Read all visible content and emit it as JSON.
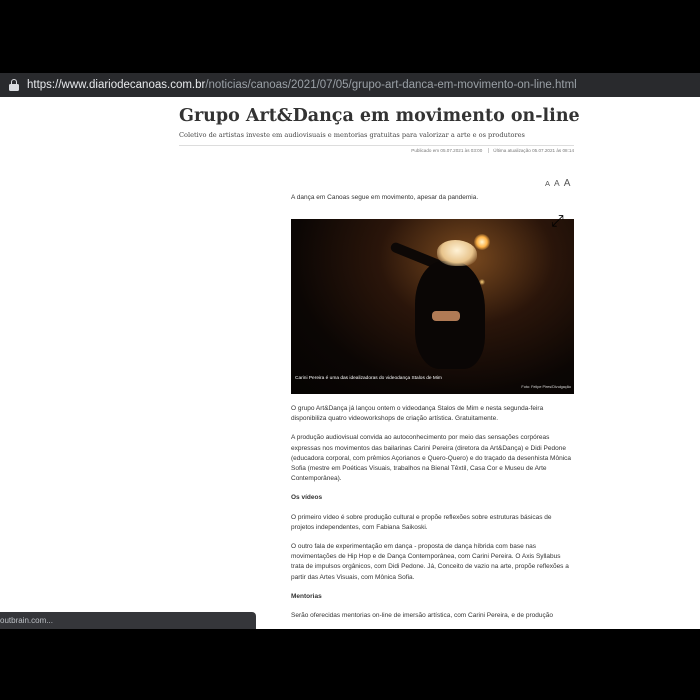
{
  "browser": {
    "url_host": "https://www.diariodecanoas.com.br",
    "url_path": "/noticias/canoas/2021/07/05/grupo-art-danca-em-movimento-on-line.html",
    "status_text": "outbrain.com..."
  },
  "article": {
    "title": "Grupo Art&Dança em movimento on-line",
    "subtitle": "Coletivo de artistas investe em audiovisuais e mentorias gratuitas para valorizar a arte e os produtores",
    "published": "Publicado em 05.07.2021 às 03:00",
    "updated": "Última atualização 05.07.2021 às 08:14",
    "font_sizes": [
      "A",
      "A",
      "A"
    ],
    "lead": "A dança em Canoas segue em movimento, apesar da pandemia.",
    "image_caption": "Carini Pereira é uma das idealizadoras do videodança Stalos de Mim",
    "image_credit": "Foto: Felipe Pires/Divulgação",
    "expand_icon_glyph": "⤢",
    "paragraphs": [
      "O grupo Art&Dança já lançou ontem o videodança Stalos de Mim e nesta segunda-feira disponibiliza quatro videoworkshops de criação artística. Gratuitamente.",
      "A produção audiovisual convida ao autoconhecimento por meio das sensações corpóreas expressas nos movimentos das bailarinas Carini Pereira (diretora da Art&Dança) e Didi Pedone (educadora corporal, com prêmios Açorianos e Quero-Quero) e do traçado da desenhista Mônica Sofia (mestre em Poéticas Visuais, trabalhos na Bienal Têxtil, Casa Cor e Museu de Arte Contemporânea)."
    ],
    "section_videos": "Os vídeos",
    "videos_paragraphs": [
      "O primeiro vídeo é sobre produção cultural e propõe reflexões sobre estruturas básicas de projetos independentes, com Fabiana Saikoski.",
      "O outro fala de experimentação em dança - proposta de dança híbrida com base nas movimentações de Hip Hop e de Dança Contemporânea, com Carini Pereira. O Axis Syllabus trata de impulsos orgânicos, com Didi Pedone. Já, Conceito de vazio na arte, propõe reflexões a partir das Artes Visuais, com Mônica Sofia."
    ],
    "section_mentorias": "Mentorias",
    "mentorias_paragraph": "Serão oferecidas mentorias on-line de imersão artística, com Carini Pereira, e de produção"
  }
}
